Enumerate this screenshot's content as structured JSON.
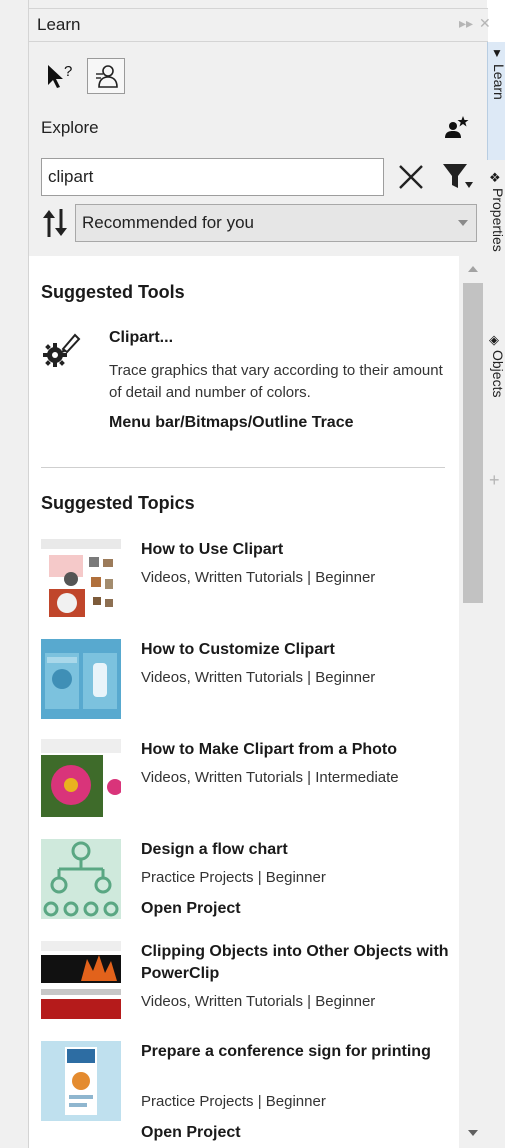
{
  "panel": {
    "title": "Learn"
  },
  "toolbar": {
    "whats_this_icon": "whats-this-icon",
    "explore_mode_icon": "learn-person-icon"
  },
  "explore": {
    "label": "Explore",
    "icon": "favorite-person-star-icon"
  },
  "search": {
    "value": "clipart",
    "clear_icon": "close-icon",
    "filter_icon": "filter-funnel-icon"
  },
  "sort": {
    "icon": "sort-arrows-icon",
    "selected": "Recommended for you"
  },
  "suggested_tools": {
    "heading": "Suggested Tools",
    "items": [
      {
        "name": "Clipart...",
        "description": "Trace graphics that vary according to their amount of detail and number of colors.",
        "path": "Menu bar/Bitmaps/Outline Trace",
        "icon": "gear-brush-trace-icon"
      }
    ]
  },
  "suggested_topics": {
    "heading": "Suggested Topics",
    "items": [
      {
        "title": "How to Use Clipart",
        "meta": "Videos, Written Tutorials | Beginner",
        "action": ""
      },
      {
        "title": "How to Customize Clipart",
        "meta": "Videos, Written Tutorials | Beginner",
        "action": ""
      },
      {
        "title": "How to Make Clipart from a Photo",
        "meta": "Videos, Written Tutorials | Intermediate",
        "action": ""
      },
      {
        "title": "Design a flow chart",
        "meta": "Practice Projects | Beginner",
        "action": "Open Project"
      },
      {
        "title": "Clipping Objects into Other Objects with PowerClip",
        "meta": "Videos, Written Tutorials | Beginner",
        "action": ""
      },
      {
        "title": "Prepare a conference sign for printing",
        "meta": "Practice Projects | Beginner",
        "action": "Open Project"
      }
    ]
  },
  "docker_tabs": [
    {
      "label": "Learn",
      "active": true
    },
    {
      "label": "Properties",
      "active": false
    },
    {
      "label": "Objects",
      "active": false
    }
  ],
  "colors": {
    "panel_bg": "#f0f0f0",
    "content_bg": "#ffffff",
    "active_tab_bg": "#dde9f6"
  }
}
